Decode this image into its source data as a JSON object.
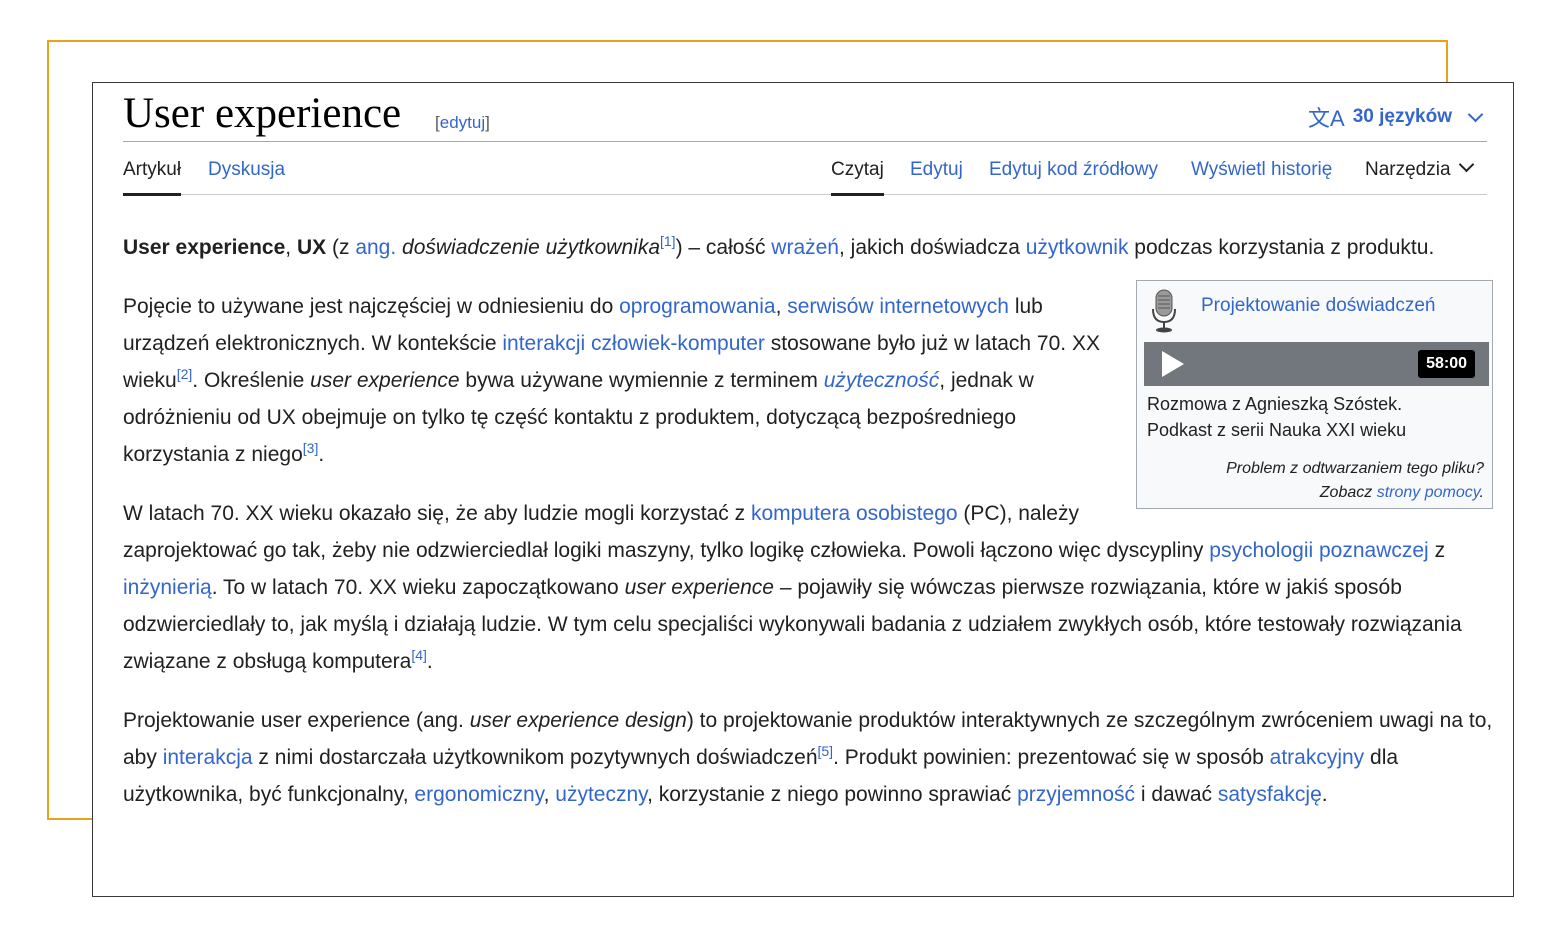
{
  "header": {
    "title": "User experience",
    "edit_open": "[",
    "edit_label": "edytuj",
    "edit_close": "]",
    "languages": "30 języków",
    "lang_icon": "文A"
  },
  "tabs": {
    "article": "Artykuł",
    "talk": "Dyskusja",
    "read": "Czytaj",
    "edit": "Edytuj",
    "edit_source": "Edytuj kod źródłowy",
    "history": "Wyświetl historię",
    "tools": "Narzędzia"
  },
  "audio": {
    "title": "Projektowanie doświadczeń",
    "duration": "58:00",
    "desc_line1": "Rozmowa z Agnieszką Szóstek.",
    "desc_line2": "Podkast z serii Nauka XXI wieku",
    "help_line1": "Problem z odtwarzaniem tego pliku?",
    "help_see": "Zobacz",
    "help_link": "strony pomocy",
    "help_end": "."
  },
  "p1": {
    "b1": "User experience",
    "t1": ", ",
    "b2": "UX",
    "t2": " (z ",
    "l1": "ang.",
    "t3": " ",
    "i1": "doświadczenie użytkownika",
    "s1": "[1]",
    "t4": ") – całość ",
    "l2": "wrażeń",
    "t5": ", jakich doświadcza ",
    "l3": "użytkownik",
    "t6": " podczas korzystania z produktu."
  },
  "p2": {
    "t1": "Pojęcie to używane jest najczęściej w odniesieniu do ",
    "l1": "oprogramowania",
    "t2": ", ",
    "l2": "serwisów internetowych",
    "t3": " lub urządzeń elektronicznych. W kontekście ",
    "l3": "interakcji człowiek-komputer",
    "t4": " stosowane było już w latach 70. XX wieku",
    "s1": "[2]",
    "t5": ". Określenie ",
    "i1": "user experience",
    "t6": " bywa używane wymiennie z terminem ",
    "l4": "użyteczność",
    "t7": ", jednak w odróżnieniu od UX obejmuje on tylko tę część kontaktu z produktem, dotyczącą bezpośredniego korzystania z niego",
    "s2": "[3]",
    "t8": "."
  },
  "p3": {
    "t1": "W latach 70. XX wieku okazało się, że aby ludzie mogli korzystać z ",
    "l1": "komputera osobistego",
    "t2": " (PC), należy zaprojektować go tak, żeby nie odzwierciedlał logiki maszyny, tylko logikę człowieka. Powoli łączono więc dyscypliny ",
    "l2": "psychologii poznawczej",
    "t3": " z ",
    "l3": "inżynierią",
    "t4": ". To w latach 70. XX wieku zapoczątkowano ",
    "i1": "user experience",
    "t5": " – pojawiły się wówczas pierwsze rozwiązania, które w jakiś sposób odzwierciedlały to, jak myślą i działają ludzie. W tym celu specjaliści wykonywali badania z udziałem zwykłych osób, które testowały rozwiązania związane z obsługą komputera",
    "s1": "[4]",
    "t6": "."
  },
  "p4": {
    "t1": "Projektowanie user experience (ang. ",
    "i1": "user experience design",
    "t2": ") to projektowanie produktów interaktywnych ze szczególnym zwróceniem uwagi na to, aby ",
    "l1": "interakcja",
    "t3": " z nimi dostarczała użytkownikom pozytywnych doświadczeń",
    "s1": "[5]",
    "t4": ". Produkt powinien: prezentować się w sposób ",
    "l2": "atrakcyjny",
    "t5": " dla użytkownika, być funkcjonalny, ",
    "l3": "ergonomiczny",
    "t6": ", ",
    "l4": "użyteczny",
    "t7": ", korzystanie z niego powinno sprawiać ",
    "l5": "przyjemność",
    "t8": " i dawać ",
    "l6": "satysfakcję",
    "t9": "."
  }
}
